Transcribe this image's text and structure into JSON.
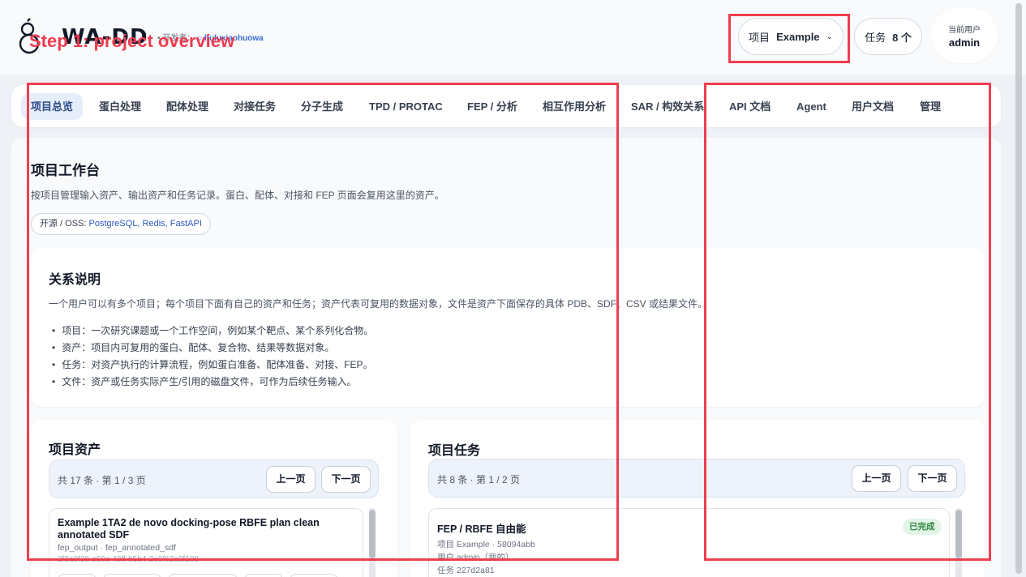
{
  "annotation": {
    "step_label": "Step 1: project overview",
    "color": "#ee3e4f"
  },
  "header": {
    "logo_text": "WA-DD",
    "developer_label": "• 开发者：",
    "developer_link": "huluxiaohuowa",
    "project_label": "项目",
    "project_value": "Example",
    "tasks_label": "任务",
    "tasks_value": "8 个",
    "user_label": "当前用户",
    "user_value": "admin"
  },
  "nav": {
    "items": [
      {
        "label": "项目总览",
        "active": true
      },
      {
        "label": "蛋白处理"
      },
      {
        "label": "配体处理"
      },
      {
        "label": "对接任务"
      },
      {
        "label": "分子生成"
      },
      {
        "label": "TPD / PROTAC"
      },
      {
        "label": "FEP / 分析"
      },
      {
        "label": "相互作用分析"
      },
      {
        "label": "SAR / 构效关系"
      },
      {
        "label": "API 文档"
      },
      {
        "label": "Agent"
      },
      {
        "label": "用户文档"
      },
      {
        "label": "管理"
      }
    ]
  },
  "workbench": {
    "title": "项目工作台",
    "description": "按项目管理输入资产、输出资产和任务记录。蛋白、配体、对接和 FEP 页面会复用这里的资产。",
    "oss_prefix": "开源 / OSS: ",
    "oss_links": "PostgreSQL, Redis, FastAPI"
  },
  "relations": {
    "title": "关系说明",
    "description": "一个用户可以有多个项目；每个项目下面有自己的资产和任务；资产代表可复用的数据对象，文件是资产下面保存的具体 PDB、SDF、CSV 或结果文件。",
    "items": [
      "项目：一次研究课题或一个工作空间，例如某个靶点、某个系列化合物。",
      "资产：项目内可复用的蛋白、配体、复合物、结果等数据对象。",
      "任务：对资产执行的计算流程，例如蛋白准备、配体准备、对接、FEP。",
      "文件：资产或任务实际产生/引用的磁盘文件，可作为后续任务输入。"
    ]
  },
  "assets": {
    "title": "项目资产",
    "pager_info": "共 17 条 · 第 1 / 3 页",
    "prev": "上一页",
    "next": "下一页",
    "first_item": {
      "name": "Example 1TA2 de novo docking-pose RBFE plan clean annotated SDF",
      "type": "fep_output · fep_annotated_sdf",
      "id": "2f8a0f38-a60c-48ff-b5b4-2e0f62a0f108"
    }
  },
  "tasks": {
    "title": "项目任务",
    "pager_info": "共 8 条 · 第 1 / 2 页",
    "prev": "上一页",
    "next": "下一页",
    "first_item": {
      "name": "FEP / RBFE 自由能",
      "status": "已完成",
      "project": "项目 Example · 58094abb",
      "user": "用户 admin（我的）",
      "task_id": "任务 227d2a81"
    }
  }
}
